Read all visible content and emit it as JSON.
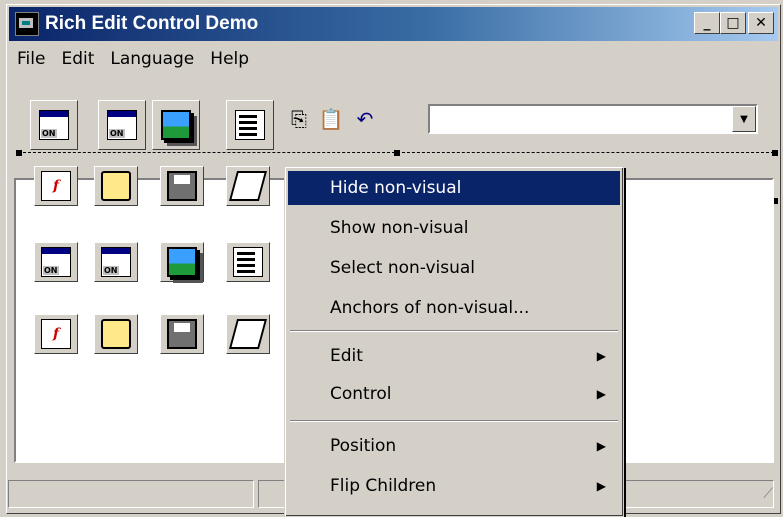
{
  "window": {
    "title": "Rich Edit Control Demo",
    "controls": {
      "minimize": "_",
      "maximize": "□",
      "close": "✕"
    }
  },
  "menubar": [
    "File",
    "Edit",
    "Language",
    "Help"
  ],
  "toolbar": {
    "icons": [
      "form-button-icon",
      "form-button-icon",
      "picture-icon",
      "list-icon",
      "copy-icon",
      "paste-icon",
      "undo-icon"
    ],
    "combo_value": ""
  },
  "client": {
    "rows": [
      [
        "font-icon",
        "folder-icon",
        "disk-icon",
        "printer-icon"
      ],
      [
        "form-button-icon",
        "form-button-icon",
        "picture-icon",
        "list-icon"
      ],
      [
        "font-icon",
        "folder-icon",
        "disk-icon",
        "printer-icon"
      ]
    ]
  },
  "context_menu": {
    "items": [
      {
        "label": "Hide non-visual",
        "selected": true,
        "submenu": false
      },
      {
        "label": "Show non-visual",
        "selected": false,
        "submenu": false
      },
      {
        "label": "Select non-visual",
        "selected": false,
        "submenu": false
      },
      {
        "label": "Anchors of non-visual...",
        "selected": false,
        "submenu": false
      },
      {
        "label": "Edit",
        "selected": false,
        "submenu": true
      },
      {
        "label": "Control",
        "selected": false,
        "submenu": true
      },
      {
        "label": "Position",
        "selected": false,
        "submenu": true
      },
      {
        "label": "Flip Children",
        "selected": false,
        "submenu": true
      }
    ],
    "submenu_arrow": "▶"
  },
  "colors": {
    "face": "#d4d0c8",
    "title_start": "#0a246a",
    "title_end": "#a6caf0",
    "highlight": "#0a246a"
  }
}
